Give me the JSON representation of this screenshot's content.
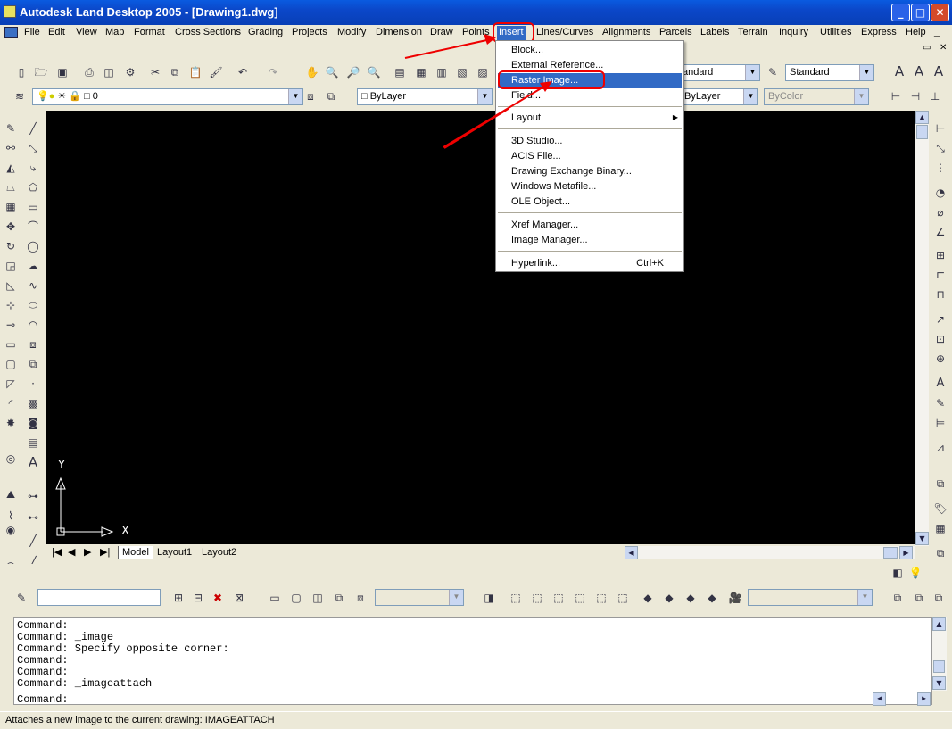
{
  "window": {
    "title": "Autodesk Land Desktop 2005 - [Drawing1.dwg]",
    "minimize": "_",
    "maximize": "□",
    "close": "✕",
    "doc_restore": "▭",
    "doc_close": "✕",
    "doc_min": "_"
  },
  "menu": {
    "items": [
      "File",
      "Edit",
      "View",
      "Map",
      "Format",
      "Cross Sections",
      "Grading",
      "Projects",
      "Modify",
      "Dimension",
      "Draw",
      "Points",
      "Insert",
      "Lines/Curves",
      "Alignments",
      "Parcels",
      "Labels",
      "Terrain",
      "Inquiry",
      "Utilities",
      "Express",
      "Help"
    ],
    "active": "Insert"
  },
  "toolbar": {
    "layer_value": "0",
    "color_value": "ByLayer",
    "linetype_value": "ByLayer",
    "lineweight_value": "ByColor",
    "textstyle_value": "andard",
    "dimstyle_value": "Standard"
  },
  "insert_menu": {
    "items": [
      {
        "label": "Block...",
        "shortcut": "",
        "submenu": false,
        "selected": false
      },
      {
        "label": "External Reference...",
        "shortcut": "",
        "submenu": false,
        "selected": false
      },
      {
        "label": "Raster Image...",
        "shortcut": "",
        "submenu": false,
        "selected": true
      },
      {
        "label": "Field...",
        "shortcut": "",
        "submenu": false,
        "selected": false
      },
      {
        "label": "Layout",
        "shortcut": "",
        "submenu": true,
        "selected": false
      },
      {
        "label": "3D Studio...",
        "shortcut": "",
        "submenu": false,
        "selected": false
      },
      {
        "label": "ACIS File...",
        "shortcut": "",
        "submenu": false,
        "selected": false
      },
      {
        "label": "Drawing Exchange Binary...",
        "shortcut": "",
        "submenu": false,
        "selected": false
      },
      {
        "label": "Windows Metafile...",
        "shortcut": "",
        "submenu": false,
        "selected": false
      },
      {
        "label": "OLE Object...",
        "shortcut": "",
        "submenu": false,
        "selected": false
      },
      {
        "label": "Xref Manager...",
        "shortcut": "",
        "submenu": false,
        "selected": false
      },
      {
        "label": "Image Manager...",
        "shortcut": "",
        "submenu": false,
        "selected": false
      },
      {
        "label": "Hyperlink...",
        "shortcut": "Ctrl+K",
        "submenu": false,
        "selected": false
      }
    ]
  },
  "drawing": {
    "ucs_x": "X",
    "ucs_y": "Y",
    "background": "#000000"
  },
  "tabs": [
    "Model",
    "Layout1",
    "Layout2"
  ],
  "active_tab": "Model",
  "command_window": {
    "lines": [
      "Command:",
      "Command: _image",
      "Command: Specify opposite corner:",
      "Command:",
      "Command:",
      "Command: _imageattach"
    ],
    "prompt": "Command:"
  },
  "status": {
    "text": "Attaches a new image to the current drawing:  IMAGEATTACH"
  },
  "colors": {
    "titlebar": "#0b47c9",
    "highlight": "#316ac5",
    "annotation": "#e00000"
  }
}
